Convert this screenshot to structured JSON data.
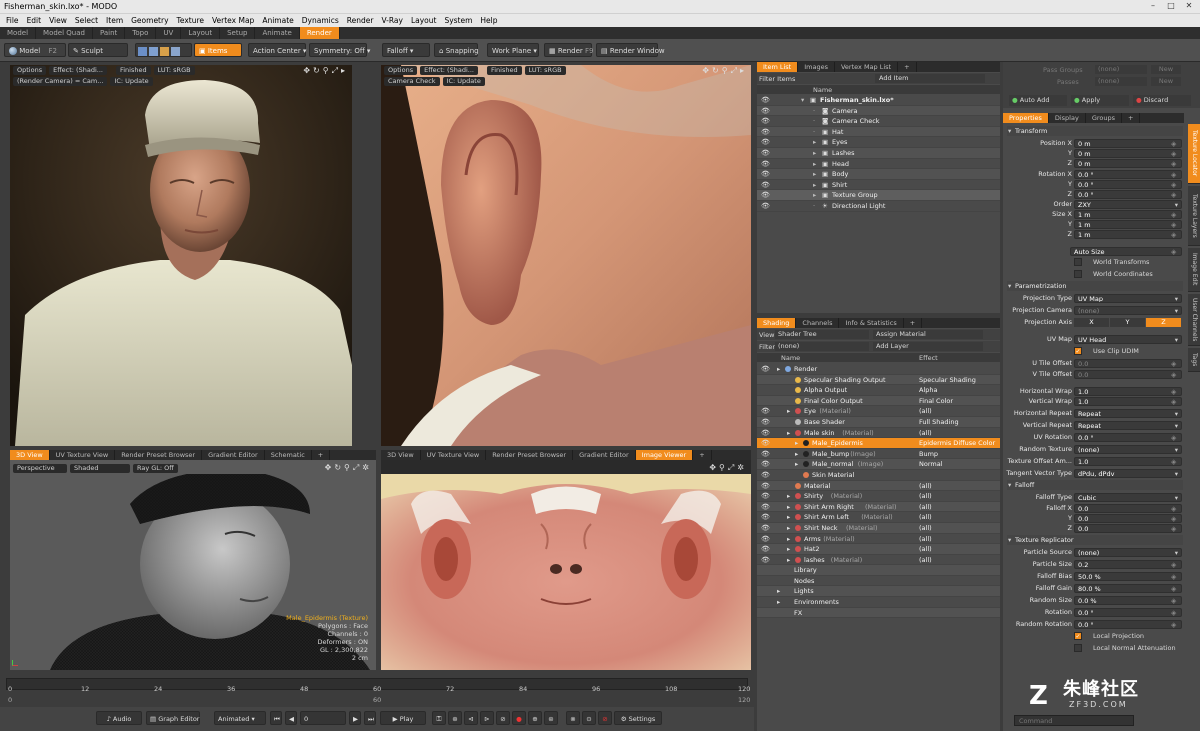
{
  "window": {
    "title": "Fisherman_skin.lxo* - MODO",
    "min": "–",
    "max": "□",
    "close": "✕"
  },
  "menu": [
    "File",
    "Edit",
    "View",
    "Select",
    "Item",
    "Geometry",
    "Texture",
    "Vertex Map",
    "Animate",
    "Dynamics",
    "Render",
    "V-Ray",
    "Layout",
    "System",
    "Help"
  ],
  "layout_tabs": [
    "Model",
    "Model Quad",
    "Paint",
    "Topo",
    "UV",
    "Layout",
    "Setup",
    "Animate",
    "Render"
  ],
  "active_layout_tab": "Render",
  "toolbar": {
    "model": "Model",
    "model_key": "F2",
    "sculpt": "Sculpt",
    "items": "Items",
    "action_center": "Action Center ▾",
    "symmetry": "Symmetry: Off ▾",
    "falloff": "Falloff ▾",
    "snapping": "Snapping",
    "work_plane": "Work Plane ▾",
    "render": "Render",
    "render_key": "F9",
    "render_window": "Render Window"
  },
  "viewport_tl": {
    "chips": [
      "Options",
      "Effect: (Shadi...",
      "Finished",
      "LUT: sRGB"
    ],
    "chips2": [
      "(Render Camera) = Cam...",
      "IC: Update"
    ]
  },
  "viewport_tr": {
    "chips": [
      "Options",
      "Effect: (Shadi...",
      "Finished",
      "LUT: sRGB"
    ],
    "chips2": [
      "Camera Check",
      "IC: Update"
    ]
  },
  "viewport_bl": {
    "tabs": [
      "3D View",
      "UV Texture View",
      "Render Preset Browser",
      "Gradient Editor",
      "Schematic",
      "+"
    ],
    "chips": [
      "Perspective",
      "Shaded",
      "Ray GL: Off"
    ],
    "info_title": "Male_Epidermis (Texture)",
    "info": [
      "Polygons : Face",
      "Channels : 0",
      "Deformers : ON",
      "GL : 2,300,822",
      "2 cm"
    ]
  },
  "viewport_br": {
    "tabs": [
      "3D View",
      "UV Texture View",
      "Render Preset Browser",
      "Gradient Editor",
      "Image Viewer",
      "+"
    ]
  },
  "item_list": {
    "tabs": [
      "Item List",
      "Images",
      "Vertex Map List",
      "+"
    ],
    "filter": "Filter Items",
    "add": "Add Item",
    "col_name": "Name",
    "items": [
      "Fisherman_skin.lxo*",
      "Camera",
      "Camera Check",
      "Hat",
      "Eyes",
      "Lashes",
      "Head",
      "Body",
      "Shirt",
      "Texture Group",
      "Directional Light"
    ]
  },
  "shading": {
    "tabs": [
      "Shading",
      "Channels",
      "Info & Statistics",
      "+"
    ],
    "view_label": "View",
    "view_value": "Shader Tree",
    "assign": "Assign Material",
    "filter_label": "Filter",
    "filter_value": "(none)",
    "add_layer": "Add Layer",
    "col_name": "Name",
    "col_effect": "Effect",
    "rows": [
      {
        "name": "Render",
        "tag": "",
        "effect": "",
        "color": "#7fa8e0"
      },
      {
        "name": "Specular Shading Output",
        "tag": "",
        "effect": "Specular Shading",
        "color": "#e8b84a"
      },
      {
        "name": "Alpha Output",
        "tag": "",
        "effect": "Alpha",
        "color": "#e8b84a"
      },
      {
        "name": "Final Color Output",
        "tag": "",
        "effect": "Final Color",
        "color": "#e8b84a"
      },
      {
        "name": "Eye",
        "tag": "(Material)",
        "effect": "(all)",
        "color": "#d05050"
      },
      {
        "name": "Base Shader",
        "tag": "",
        "effect": "Full Shading",
        "color": "#bbbbbb"
      },
      {
        "name": "Male skin",
        "tag": "(Material)",
        "effect": "(all)",
        "color": "#d05050"
      },
      {
        "name": "Male_Epidermis",
        "tag": "",
        "effect": "Epidermis Diffuse Color",
        "color": "#222222"
      },
      {
        "name": "Male_bump",
        "tag": "(Image)",
        "effect": "Bump",
        "color": "#222222"
      },
      {
        "name": "Male_normal",
        "tag": "(Image)",
        "effect": "Normal",
        "color": "#222222"
      },
      {
        "name": "Skin Material",
        "tag": "",
        "effect": "",
        "color": "#e07a50"
      },
      {
        "name": "Material",
        "tag": "",
        "effect": "(all)",
        "color": "#e07a50"
      },
      {
        "name": "Shirty",
        "tag": "(Material)",
        "effect": "(all)",
        "color": "#d05050"
      },
      {
        "name": "Shirt Arm Right",
        "tag": "(Material)",
        "effect": "(all)",
        "color": "#d05050"
      },
      {
        "name": "Shirt Arm Left",
        "tag": "(Material)",
        "effect": "(all)",
        "color": "#d05050"
      },
      {
        "name": "Shirt Neck",
        "tag": "(Material)",
        "effect": "(all)",
        "color": "#d05050"
      },
      {
        "name": "Arms",
        "tag": "(Material)",
        "effect": "(all)",
        "color": "#d05050"
      },
      {
        "name": "Hat2",
        "tag": "",
        "effect": "(all)",
        "color": "#d05050"
      },
      {
        "name": "lashes",
        "tag": "(Material)",
        "effect": "(all)",
        "color": "#d05050"
      },
      {
        "name": "Library",
        "tag": "",
        "effect": "",
        "color": ""
      },
      {
        "name": "Nodes",
        "tag": "",
        "effect": "",
        "color": ""
      },
      {
        "name": "Lights",
        "tag": "",
        "effect": "",
        "color": ""
      },
      {
        "name": "Environments",
        "tag": "",
        "effect": "",
        "color": ""
      },
      {
        "name": "FX",
        "tag": "",
        "effect": "",
        "color": ""
      }
    ]
  },
  "props": {
    "pass_groups": "Pass Groups",
    "passes": "Passes",
    "none": "(none)",
    "new": "New",
    "auto_add": "Auto Add",
    "apply": "Apply",
    "discard": "Discard",
    "tabs": [
      "Properties",
      "Display",
      "Groups",
      "+"
    ],
    "side_tabs": [
      "Texture Locator",
      "Texture Layers",
      "Image Edit",
      "User Channels",
      "Tags"
    ],
    "transform": "Transform",
    "pos_label": "Position X",
    "rot_label": "Rotation X",
    "size_label": "Size X",
    "order_label": "Order",
    "y": "Y",
    "z": "Z",
    "pos": [
      "0 m",
      "0 m",
      "0 m"
    ],
    "rot": [
      "0.0 °",
      "0.0 °",
      "0.0 °"
    ],
    "order": "ZXY",
    "size": [
      "1 m",
      "1 m",
      "1 m"
    ],
    "auto_size": "Auto Size",
    "world_transforms": "World Transforms",
    "world_coords": "World Coordinates",
    "parametrization": "Parametrization",
    "proj_type_label": "Projection Type",
    "proj_type": "UV Map",
    "proj_cam_label": "Projection Camera",
    "proj_cam": "(none)",
    "proj_axis_label": "Projection Axis",
    "axes": [
      "X",
      "Y",
      "Z"
    ],
    "uvmap_label": "UV Map",
    "uvmap": "UV Head",
    "use_clip_udim": "Use Clip UDIM",
    "u_tile_label": "U Tile Offset",
    "v_tile_label": "V Tile Offset",
    "tile_val": "0.0",
    "hwrap_label": "Horizontal Wrap",
    "vwrap_label": "Vertical Wrap",
    "wrap_val": "1.0",
    "hrep_label": "Horizontal Repeat",
    "vrep_label": "Vertical Repeat",
    "repeat": "Repeat",
    "uvrot_label": "UV Rotation",
    "uvrot": "0.0 °",
    "rand_tex_label": "Random Texture",
    "rand_tex": "(none)",
    "tex_off_label": "Texture Offset Am...",
    "tex_off": "1.0",
    "tangent_label": "Tangent Vector Type",
    "tangent": "dPdu, dPdv",
    "falloff": "Falloff",
    "falloff_type_label": "Falloff Type",
    "falloff_type": "Cubic",
    "falloff_x_label": "Falloff X",
    "falloff_vals": [
      "0.0",
      "0.0",
      "0.0"
    ],
    "replicator": "Texture Replicator",
    "part_src_label": "Particle Source",
    "part_src": "(none)",
    "part_size_label": "Particle Size",
    "part_size": "0.2",
    "fbias_label": "Falloff Bias",
    "fbias": "50.0 %",
    "fgain_label": "Falloff Gain",
    "fgain": "80.0 %",
    "rsize_label": "Random Size",
    "rsize": "0.0 %",
    "rot2_label": "Rotation",
    "rot2": "0.0 °",
    "rrot_label": "Random Rotation",
    "rrot": "0.0 °",
    "local_proj": "Local Projection",
    "local_norm": "Local Normal Attenuation"
  },
  "timeline": {
    "ticks": [
      "0",
      "12",
      "24",
      "36",
      "48",
      "60",
      "72",
      "84",
      "96",
      "108",
      "120"
    ],
    "ticks2": [
      "0",
      "",
      "",
      "",
      "",
      "60",
      "",
      "",
      "",
      "",
      "120"
    ],
    "end": "120"
  },
  "transport": {
    "audio": "Audio",
    "graph": "Graph Editor",
    "animated": "Animated",
    "frame": "0",
    "play": "Play",
    "settings": "Settings"
  },
  "command": "Command",
  "watermark": {
    "cn": "朱峰社区",
    "en": "ZF3D.COM"
  },
  "colors": {
    "accent": "#f18c1d"
  }
}
